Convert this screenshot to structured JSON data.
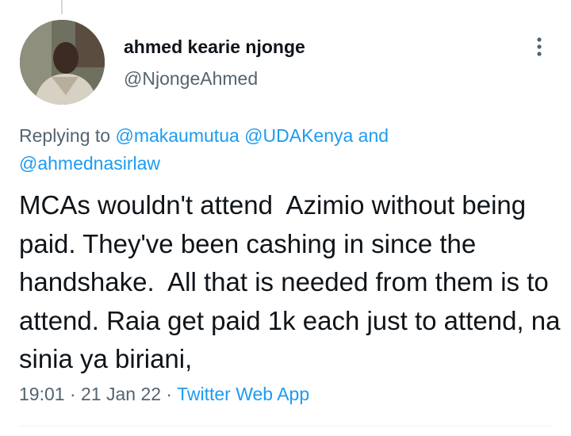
{
  "author": {
    "display_name": "ahmed kearie njonge",
    "handle": "@NjongeAhmed"
  },
  "reply": {
    "prefix": "Replying to ",
    "mention_1": "@makaumutua",
    "mention_2": "@UDAKenya",
    "joiner": " and",
    "mention_3": "@ahmednasirlaw"
  },
  "tweet": {
    "text": "MCAs wouldn't attend  Azimio without being paid. They've been cashing in since the handshake.  All that is needed from them is to attend. Raia get paid 1k each just to attend, na sinia ya biriani,"
  },
  "meta": {
    "time": "19:01",
    "date": "21 Jan 22",
    "separator": " · ",
    "source": "Twitter Web App"
  },
  "icons": {
    "more": "more-vertical-icon"
  },
  "colors": {
    "link": "#1d9bf0",
    "secondary_text": "#536471",
    "primary_text": "#0f1419"
  }
}
